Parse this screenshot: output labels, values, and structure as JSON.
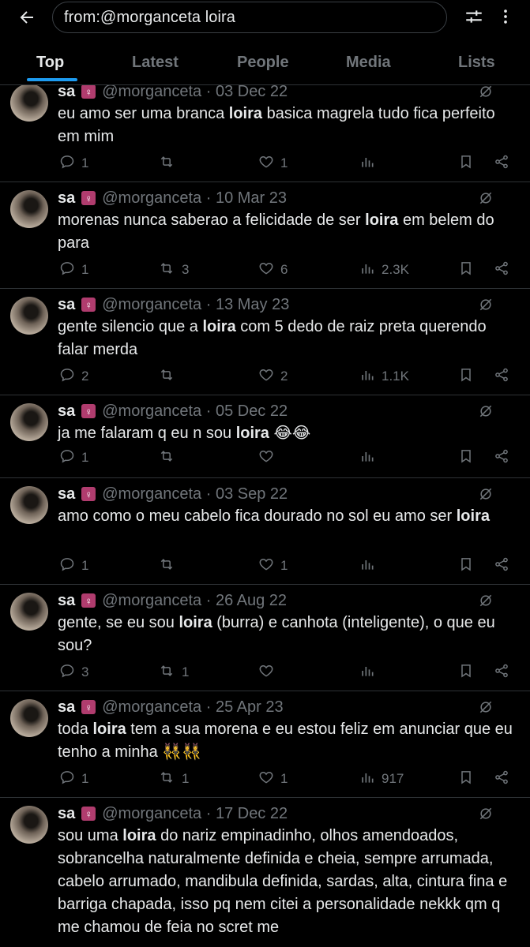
{
  "search": {
    "query": "from:@morganceta loira"
  },
  "tabs": [
    {
      "label": "Top"
    },
    {
      "label": "Latest"
    },
    {
      "label": "People"
    },
    {
      "label": "Media"
    },
    {
      "label": "Lists"
    }
  ],
  "tweets": [
    {
      "name": "sa",
      "badge": "♀",
      "handle": "@morganceta · 03 Dec 22",
      "text": [
        "eu amo ser uma branca ",
        "loira",
        " basica magrela tudo fica perfeito em mim"
      ],
      "replies": "1",
      "retweets": "",
      "likes": "1",
      "views": ""
    },
    {
      "name": "sa",
      "badge": "♀",
      "handle": "@morganceta · 10 Mar 23",
      "text": [
        "morenas nunca saberao a felicidade de ser ",
        "loira",
        " em belem do para"
      ],
      "replies": "1",
      "retweets": "3",
      "likes": "6",
      "views": "2.3K"
    },
    {
      "name": "sa",
      "badge": "♀",
      "handle": "@morganceta · 13 May 23",
      "text": [
        "gente silencio que a ",
        "loira",
        " com 5 dedo de raiz preta querendo falar merda"
      ],
      "replies": "2",
      "retweets": "",
      "likes": "2",
      "views": "1.1K"
    },
    {
      "name": "sa",
      "badge": "♀",
      "handle": "@morganceta · 05 Dec 22",
      "text": [
        "ja me falaram q eu n sou ",
        "loira",
        " 😂😂"
      ],
      "replies": "1",
      "retweets": "",
      "likes": "",
      "views": ""
    },
    {
      "name": "sa",
      "badge": "♀",
      "handle": "@morganceta · 03 Sep 22",
      "text": [
        "amo como o meu cabelo fica dourado no sol eu amo ser ",
        "loira",
        ""
      ],
      "replies": "1",
      "retweets": "",
      "likes": "1",
      "views": ""
    },
    {
      "name": "sa",
      "badge": "♀",
      "handle": "@morganceta · 26 Aug 22",
      "text": [
        "gente, se eu sou ",
        "loira",
        " (burra) e canhota (inteligente), o que eu sou?"
      ],
      "replies": "3",
      "retweets": "1",
      "likes": "",
      "views": ""
    },
    {
      "name": "sa",
      "badge": "♀",
      "handle": "@morganceta · 25 Apr 23",
      "text": [
        "toda ",
        "loira",
        " tem a sua morena e eu estou feliz em anunciar que eu tenho a minha 👯‍♀️👯‍♀️"
      ],
      "replies": "1",
      "retweets": "1",
      "likes": "1",
      "views": "917"
    },
    {
      "name": "sa",
      "badge": "♀",
      "handle": "@morganceta · 17 Dec 22",
      "text": [
        "sou uma ",
        "loira",
        " do nariz empinadinho, olhos amendoados, sobrancelha naturalmente definida e cheia, sempre arrumada, cabelo arrumado, mandibula definida, sardas, alta, cintura fina e barriga chapada, isso pq nem citei a personalidade nekkk qm q me chamou de feia no scret me"
      ],
      "replies": "",
      "retweets": "",
      "likes": "",
      "views": ""
    }
  ]
}
